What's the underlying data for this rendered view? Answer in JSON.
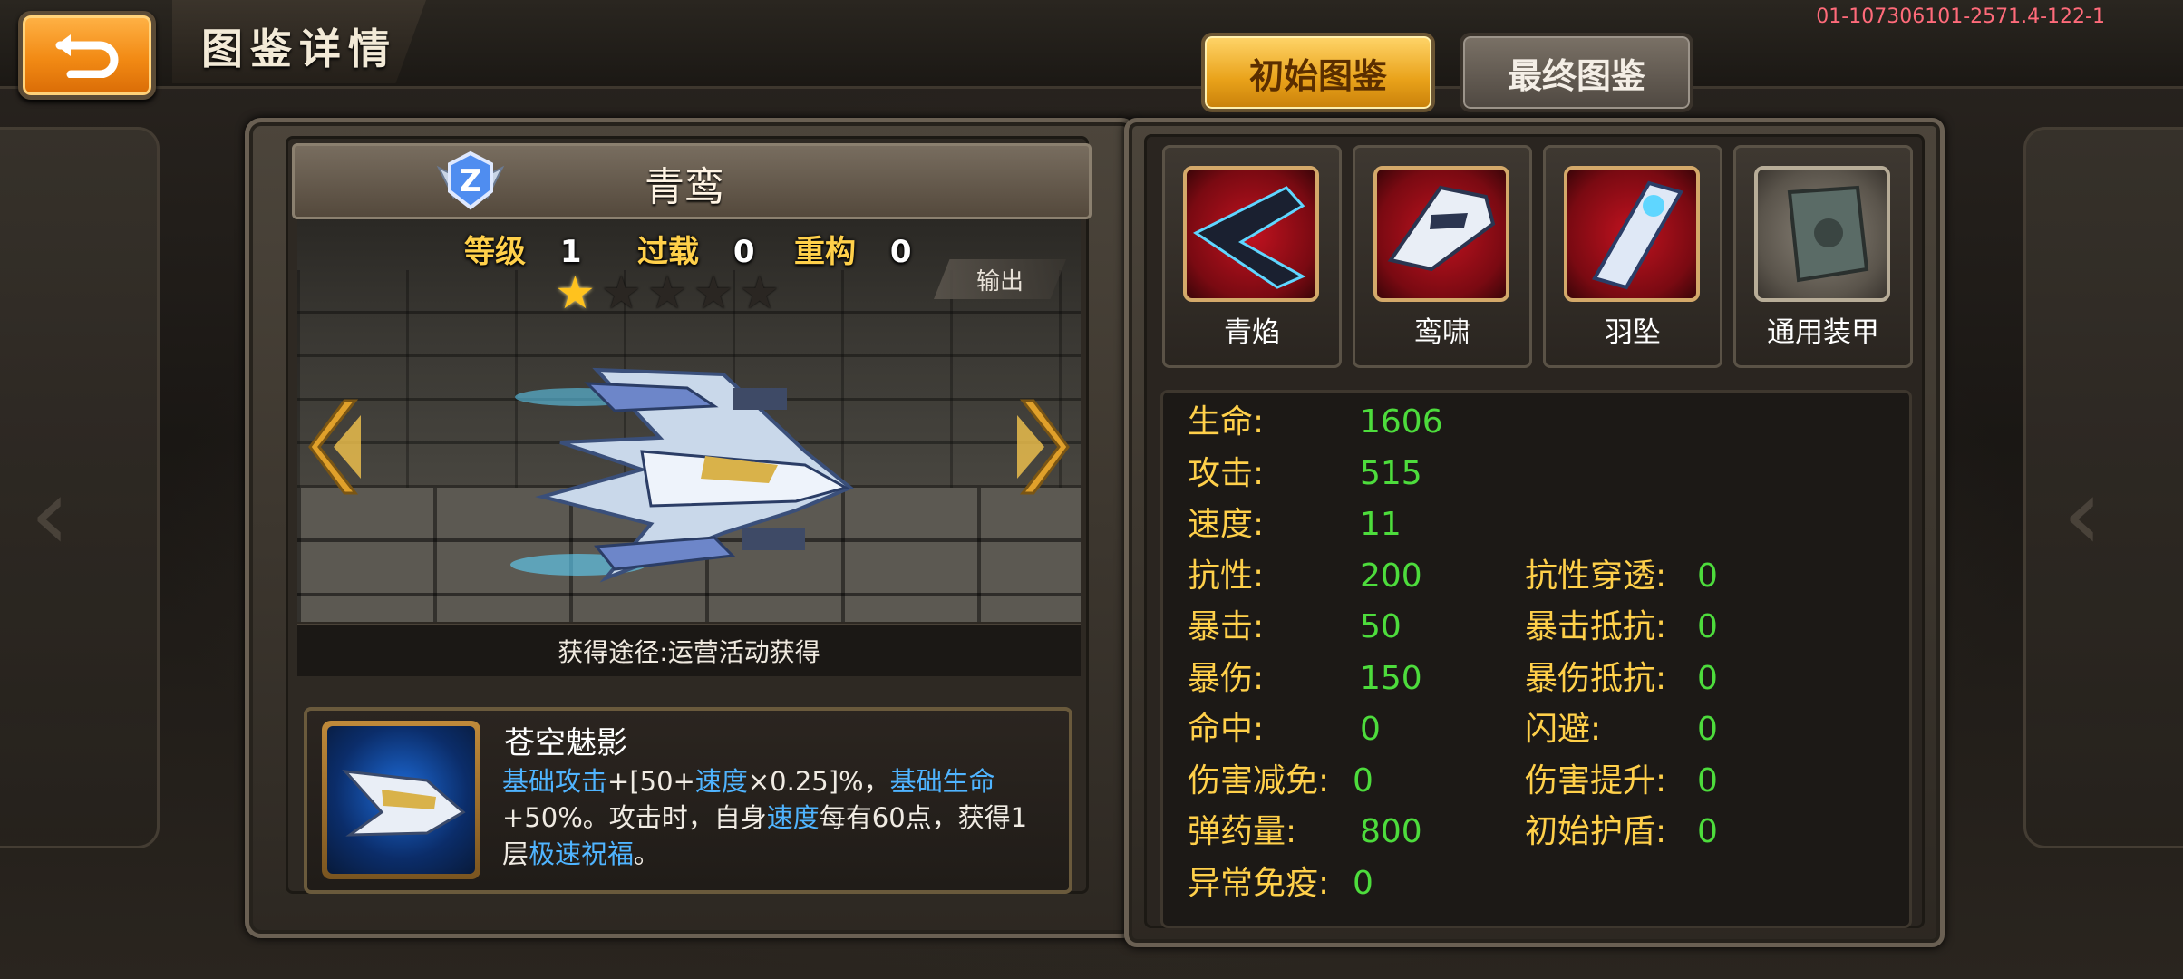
{
  "header": {
    "title": "图鉴详情",
    "version": "01-107306101-2571.4-122-1",
    "tabs": [
      {
        "label": "初始图鉴",
        "active": true
      },
      {
        "label": "最终图鉴",
        "active": false
      }
    ]
  },
  "ship": {
    "name": "青鸾",
    "rank_badge": "Z",
    "level_label": "等级",
    "level": "1",
    "overload_label": "过载",
    "overload": "0",
    "rebuild_label": "重构",
    "rebuild": "0",
    "stars_total": 5,
    "stars_filled": 1,
    "role": "输出",
    "source": "获得途径:运营活动获得"
  },
  "skill": {
    "name": "苍空魅影",
    "desc": [
      {
        "t": "基础攻击",
        "kw": true
      },
      {
        "t": "+[50+",
        "kw": false
      },
      {
        "t": "速度",
        "kw": true
      },
      {
        "t": "×0.25]%，",
        "kw": false
      },
      {
        "t": "基础生命",
        "kw": true
      },
      {
        "t": "+50%。攻击时，自身",
        "kw": false
      },
      {
        "t": "速度",
        "kw": true
      },
      {
        "t": "每有60点，获得1层",
        "kw": false
      },
      {
        "t": "极速祝福",
        "kw": true
      },
      {
        "t": "。",
        "kw": false
      }
    ]
  },
  "equipment": [
    {
      "label": "青焰",
      "icon": "flame-wing-icon",
      "frame": "red"
    },
    {
      "label": "鸾啸",
      "icon": "wing-cannon-icon",
      "frame": "red"
    },
    {
      "label": "羽坠",
      "icon": "feather-missile-icon",
      "frame": "red"
    },
    {
      "label": "通用装甲",
      "icon": "armor-plate-icon",
      "frame": "gray"
    }
  ],
  "stats_left": [
    {
      "k": "生命:",
      "v": "1606"
    },
    {
      "k": "攻击:",
      "v": "515"
    },
    {
      "k": "速度:",
      "v": "11"
    },
    {
      "k": "抗性:",
      "v": "200"
    },
    {
      "k": "暴击:",
      "v": "50"
    },
    {
      "k": "暴伤:",
      "v": "150"
    },
    {
      "k": "命中:",
      "v": "0"
    },
    {
      "k": "伤害减免:",
      "v": "0"
    },
    {
      "k": "弹药量:",
      "v": "800"
    },
    {
      "k": "异常免疫:",
      "v": "0"
    }
  ],
  "stats_right": [
    {
      "k": "抗性穿透:",
      "v": "0"
    },
    {
      "k": "暴击抵抗:",
      "v": "0"
    },
    {
      "k": "暴伤抵抗:",
      "v": "0"
    },
    {
      "k": "闪避:",
      "v": "0"
    },
    {
      "k": "伤害提升:",
      "v": "0"
    },
    {
      "k": "初始护盾:",
      "v": "0"
    }
  ],
  "colors": {
    "stat_label": "#ffd04a",
    "stat_value": "#4ddc3c",
    "keyword": "#4fb4ff",
    "accent_orange": "#f28a14"
  }
}
